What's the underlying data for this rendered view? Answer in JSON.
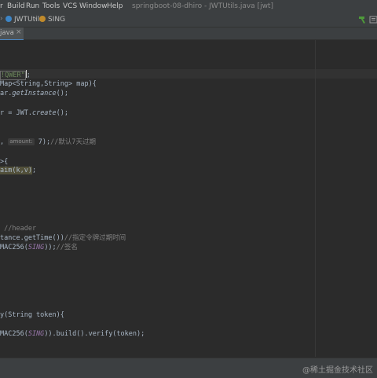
{
  "menubar": {
    "items": [
      "r",
      "Build",
      "Run",
      "Tools",
      "VCS",
      "Window",
      "Help"
    ],
    "window_title": "springboot-08-dhiro - JWTUtils.java [jwt]"
  },
  "navbar": {
    "class_name": "JWTUtils",
    "field_name": "SING"
  },
  "tab": {
    "label": "java"
  },
  "code": {
    "l1": "!QWER\"",
    "l1_suffix": ";",
    "l2": "Map<String,String> map){",
    "l3_a": "ar.",
    "l3_b": "getInstance",
    "l3_c": "();",
    "l4_a": "r = JWT.",
    "l4_b": "create",
    "l4_c": "();",
    "l5_a": ", ",
    "l5_hint": "amount:",
    "l5_b": " 7);",
    "l5_comment": "//默认7天过期",
    "l6": ">{",
    "l7_a": "aim(k,v)",
    "l7_b": ";",
    "l8": " //header",
    "l9_a": "tance.getTime())",
    "l9_comment": "//指定令牌过期时间",
    "l10_a": "MAC256(",
    "l10_const": "SING",
    "l10_b": "));",
    "l10_comment": "//签名",
    "l11": "y(String token){",
    "l12_a": "MAC256(",
    "l12_const": "SING",
    "l12_b": ")).build().verify(token);"
  },
  "statusbar": {
    "watermark": "@稀土掘金技术社区"
  },
  "icons": {
    "hammer": "hammer-icon",
    "run_config": "run-config-icon"
  },
  "colors": {
    "editor_bg": "#2b2b2b",
    "panel_bg": "#3c3f41",
    "string": "#6a8759",
    "constant": "#9876aa",
    "comment": "#808080"
  }
}
